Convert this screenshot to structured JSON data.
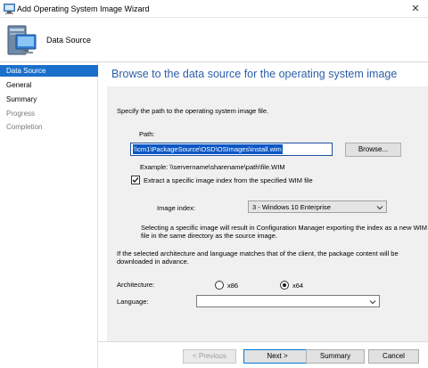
{
  "window": {
    "title": "Add Operating System Image Wizard",
    "close_glyph": "✕"
  },
  "header": {
    "title": "Data Source"
  },
  "sidebar": {
    "items": [
      {
        "label": "Data Source",
        "state": "active"
      },
      {
        "label": "General",
        "state": "normal"
      },
      {
        "label": "Summary",
        "state": "normal"
      },
      {
        "label": "Progress",
        "state": "disabled"
      },
      {
        "label": "Completion",
        "state": "disabled"
      }
    ]
  },
  "main": {
    "page_title": "Browse to the data source for the operating system image",
    "instruction": "Specify the path to the operating system image file.",
    "path_label": "Path:",
    "path_value": "\\\\cm1\\PackageSource\\OSD\\OSImages\\install.wim",
    "browse_label": "Browse...",
    "example_text": "Example:  \\\\servername\\sharename\\path\\file.WIM",
    "extract_checkbox": {
      "label": "Extract a specific image index from the specified WIM file",
      "checked": true
    },
    "image_index_label": "Image index:",
    "image_index_value": "3 - Windows 10 Enterprise",
    "selecting_note_line1": "Selecting a specific image will result in Configuration Manager exporting the index as a new WIM",
    "selecting_note_line2": "file in the same directory as the source image.",
    "arch_note_line1": "If the selected architecture and language matches that of the client, the package content will be",
    "arch_note_line2": "downloaded in advance.",
    "architecture_label": "Architecture:",
    "arch_options": [
      {
        "label": "x86",
        "selected": false
      },
      {
        "label": "x64",
        "selected": true
      }
    ],
    "language_label": "Language:",
    "language_value": ""
  },
  "footer": {
    "previous_label": "< Previous",
    "next_label": "Next >",
    "summary_label": "Summary",
    "cancel_label": "Cancel"
  },
  "colors": {
    "accent": "#1a6fca",
    "title_blue": "#2b5ea8",
    "panel_bg": "#f0f0f0"
  }
}
